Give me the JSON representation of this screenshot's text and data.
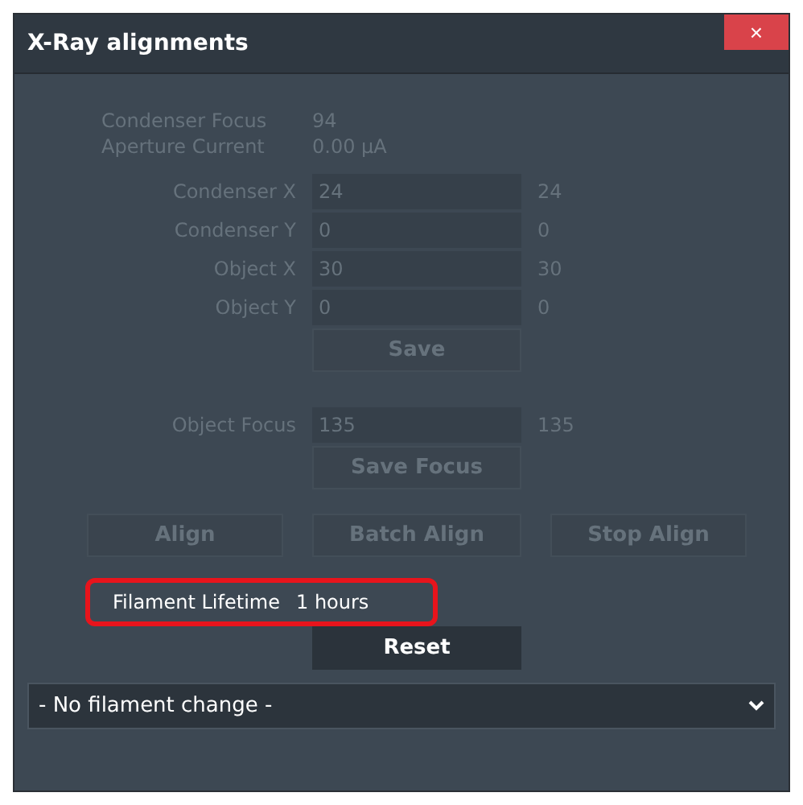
{
  "window": {
    "title": "X-Ray alignments",
    "close": "×"
  },
  "readouts": [
    {
      "label": "Condenser Focus",
      "value": "94",
      "disabled": true
    },
    {
      "label": "Aperture Current",
      "value": "0.00 µA",
      "disabled": true
    }
  ],
  "positions": [
    {
      "label": "Condenser X",
      "input": "24",
      "value": "24",
      "disabled": true
    },
    {
      "label": "Condenser Y",
      "input": "0",
      "value": "0",
      "disabled": true
    },
    {
      "label": "Object X",
      "input": "30",
      "value": "30",
      "disabled": true
    },
    {
      "label": "Object Y",
      "input": "0",
      "value": "0",
      "disabled": true
    }
  ],
  "save_button": {
    "label": "Save",
    "disabled": true
  },
  "focus": {
    "label": "Object Focus",
    "input": "135",
    "value": "135",
    "disabled": true
  },
  "save_focus_button": {
    "label": "Save Focus",
    "disabled": true
  },
  "align_buttons": [
    {
      "label": "Align",
      "disabled": true
    },
    {
      "label": "Batch Align",
      "disabled": true
    },
    {
      "label": "Stop Align",
      "disabled": true
    }
  ],
  "filament": {
    "label": "Filament Lifetime",
    "value": "1 hours",
    "highlighted": true
  },
  "reset_button": {
    "label": "Reset",
    "disabled": false
  },
  "filament_select": {
    "value": "- No filament change -"
  }
}
